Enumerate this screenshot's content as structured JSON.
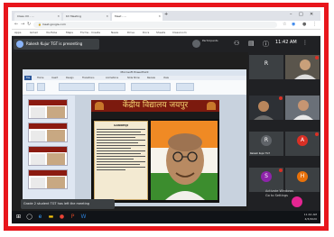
{
  "browser": {
    "tabs": [
      {
        "label": "Class XII - ..."
      },
      {
        "label": "KV Meeting"
      },
      {
        "label": "Meet - ..."
      }
    ],
    "address": "meet.google.com",
    "bookmarks": [
      "Apps",
      "Gmail",
      "YouTube",
      "Maps",
      "Forms - Create",
      "News",
      "Drive",
      "Docs",
      "Sheets",
      "Classroom"
    ]
  },
  "meet": {
    "presenter_text": "Rakesh Kujur TGT is presenting",
    "side_caption": "Participants",
    "clock": "11:42 AM",
    "toast": "Grade 2 student TGT has left the meeting"
  },
  "ppt": {
    "window_title": "Microsoft PowerPoint",
    "tabs": [
      "File",
      "Home",
      "Insert",
      "Design",
      "Transitions",
      "Animations",
      "Slide Show",
      "Review",
      "View"
    ],
    "slide_title": "केंद्रीय विद्यालय जयपुर",
    "slide_subtitle": "",
    "text_heading": "GANDHIJI"
  },
  "participants": [
    {
      "initial": "R",
      "name": "",
      "color": "#5f6368",
      "video": false
    },
    {
      "initial": "",
      "name": "",
      "color": "#3c4043",
      "video": true
    },
    {
      "initial": "",
      "name": "",
      "color": "#3c4043",
      "video": true
    },
    {
      "initial": "",
      "name": "",
      "color": "#3c4043",
      "video": true
    },
    {
      "initial": "R",
      "name": "Rakesh Kujur TGT",
      "color": "#5f6368",
      "video": false
    },
    {
      "initial": "A",
      "name": "",
      "color": "#d93025",
      "video": false
    },
    {
      "initial": "S",
      "name": "",
      "color": "#8e24aa",
      "video": false
    },
    {
      "initial": "H",
      "name": "",
      "color": "#e8710a",
      "video": false
    }
  ],
  "overlay": {
    "activate_line1": "Activate Windows",
    "activate_line2": "Go to Settings"
  },
  "taskbar": {
    "time": "11:42 AM",
    "date": "4/3/2020"
  }
}
